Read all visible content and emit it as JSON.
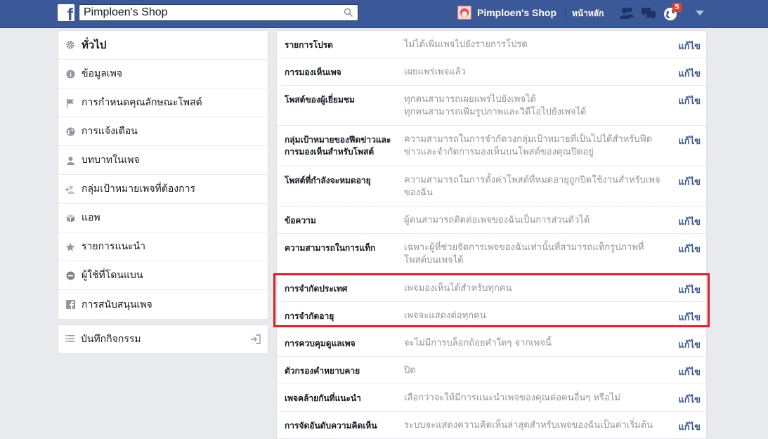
{
  "header": {
    "search_value": "Pimploen's Shop",
    "profile_name": "Pimploen's Shop",
    "home_label": "หน้าหลัก",
    "notification_count": "5"
  },
  "sidebar": {
    "items": [
      {
        "label": "ทั่วไป",
        "icon": "gear-icon"
      },
      {
        "label": "ข้อมูลเพจ",
        "icon": "info-icon"
      },
      {
        "label": "การกำหนดคุณลักษณะโพสต์",
        "icon": "flag-icon"
      },
      {
        "label": "การแจ้งเตือน",
        "icon": "globe-icon"
      },
      {
        "label": "บทบาทในเพจ",
        "icon": "person-icon"
      },
      {
        "label": "กลุ่มเป้าหมายเพจที่ต้องการ",
        "icon": "person-plus-icon"
      },
      {
        "label": "แอพ",
        "icon": "cube-icon"
      },
      {
        "label": "รายการแนะนำ",
        "icon": "star-icon"
      },
      {
        "label": "ผู้ใช้ที่โดนแบน",
        "icon": "ban-icon"
      },
      {
        "label": "การสนับสนุนเพจ",
        "icon": "facebook-icon"
      }
    ],
    "activity_log": {
      "label": "บันทึกกิจกรรม",
      "icon": "list-icon"
    }
  },
  "settings": {
    "edit_label": "แก้ไข",
    "rows": [
      {
        "label": "รายการโปรด",
        "value": "ไม่ได้เพิ่มเพจไปยังรายการโปรด"
      },
      {
        "label": "การมองเห็นเพจ",
        "value": "เผยแพร่เพจแล้ว"
      },
      {
        "label": "โพสต์ของผู้เยี่ยมชม",
        "value": "ทุกคนสามารถเผยแพร่ไปยังเพจได้",
        "value2": "ทุกคนสามารถเพิ่มรูปภาพและวิดีโอไปยังเพจได้"
      },
      {
        "label": "กลุ่มเป้าหมายของฟีดข่าวและการมองเห็นสำหรับโพสต์",
        "value": "ความสามารถในการจำกัดวงกลุ่มเป้าหมายที่เป็นไปได้สำหรับฟีดข่าวและจำกัดการมองเห็นบนโพสต์ของคุณปิดอยู่"
      },
      {
        "label": "โพสต์ที่กำลังจะหมดอายุ",
        "value": "ความสามารถในการตั้งค่าโพสต์ที่หมดอายุถูกปิดใช้งานสำหรับเพจของฉัน"
      },
      {
        "label": "ข้อความ",
        "value": "ผู้คนสามารถติดต่อเพจของฉันเป็นการส่วนตัวได้"
      },
      {
        "label": "ความสามารถในการแท็ก",
        "value": "เฉพาะผู้ที่ช่วยจัดการเพจของฉันเท่านั้นที่สามารถแท็กรูปภาพที่โพสต์บนเพจได้"
      },
      {
        "label": "การจำกัดประเทศ",
        "value": "เพจมองเห็นได้สำหรับทุกคน"
      },
      {
        "label": "การจำกัดอายุ",
        "value": "เพจจะแสดงต่อทุกคน"
      },
      {
        "label": "การควบคุมดูแลเพจ",
        "value": "จะไม่มีการบล็อกถ้อยคำใดๆ จากเพจนี้"
      },
      {
        "label": "ตัวกรองคำหยาบคาย",
        "value": "ปิด"
      },
      {
        "label": "เพจคล้ายกันที่แนะนำ",
        "value": "เลือกว่าจะให้มีการแนะนำเพจของคุณต่อคนอื่นๆ หรือไม่"
      },
      {
        "label": "การจัดอันดับความคิดเห็น",
        "value": "ระบบจะแสดงความคิดเห็นล่าสุดสำหรับเพจของฉันเป็นค่าเริ่มต้น"
      }
    ]
  },
  "colors": {
    "brand": "#3b5998",
    "highlight": "#e01f26",
    "badge": "#f03d25"
  }
}
